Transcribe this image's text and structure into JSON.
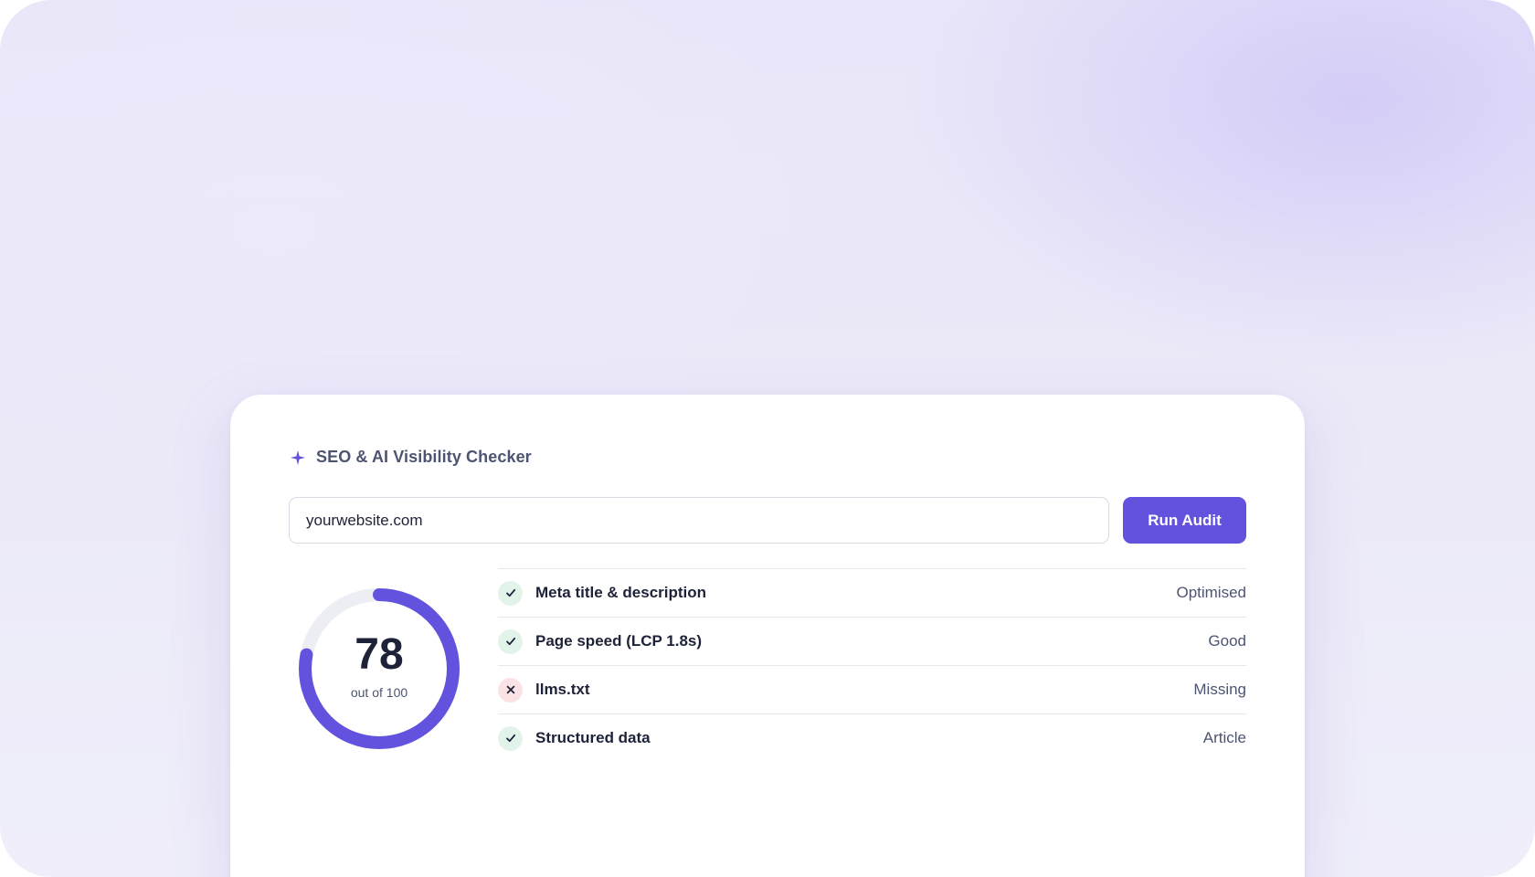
{
  "card": {
    "title": "SEO & AI Visibility Checker",
    "icon": "sparkle-icon"
  },
  "search": {
    "value": "yourwebsite.com",
    "button_label": "Run Audit"
  },
  "score": {
    "value": 78,
    "display": "78",
    "caption": "out of 100",
    "max": 100
  },
  "checks": [
    {
      "label": "Meta title & description",
      "status": "Optimised",
      "result": "pass",
      "icon": "check-icon"
    },
    {
      "label": "Page speed (LCP 1.8s)",
      "status": "Good",
      "result": "pass",
      "icon": "check-icon"
    },
    {
      "label": "llms.txt",
      "status": "Missing",
      "result": "fail",
      "icon": "cross-icon"
    },
    {
      "label": "Structured data",
      "status": "Article",
      "result": "pass",
      "icon": "check-icon"
    }
  ],
  "colors": {
    "accent": "#6252dd",
    "track": "#eceef4",
    "pass_bg": "#e2f4ea",
    "fail_bg": "#fbe3e5",
    "text_primary": "#1d2238",
    "text_secondary": "#4d5472"
  }
}
